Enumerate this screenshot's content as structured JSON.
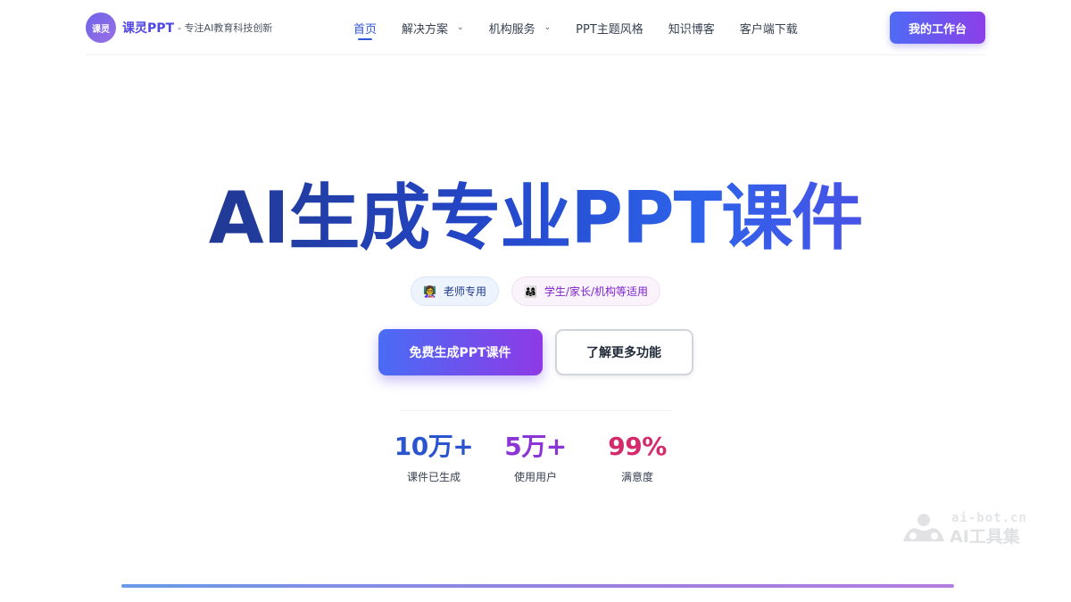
{
  "header": {
    "logo_mark": "课灵",
    "logo_name": "课灵PPT",
    "logo_tagline": "- 专注AI教育科技创新",
    "nav": [
      {
        "label": "首页",
        "active": true,
        "dropdown": false
      },
      {
        "label": "解决方案",
        "active": false,
        "dropdown": true
      },
      {
        "label": "机构服务",
        "active": false,
        "dropdown": true
      },
      {
        "label": "PPT主题风格",
        "active": false,
        "dropdown": false
      },
      {
        "label": "知识博客",
        "active": false,
        "dropdown": false
      },
      {
        "label": "客户端下载",
        "active": false,
        "dropdown": false
      }
    ],
    "workbench_label": "我的工作台"
  },
  "hero": {
    "title": "AI生成专业PPT课件",
    "tags": [
      {
        "icon": "teacher-emoji-icon",
        "label": "老师专用"
      },
      {
        "icon": "family-emoji-icon",
        "label": "学生/家长/机构等适用"
      }
    ],
    "primary_cta": "免费生成PPT课件",
    "secondary_cta": "了解更多功能"
  },
  "stats": [
    {
      "value": "10万+",
      "label": "课件已生成",
      "color": "#2b55cf"
    },
    {
      "value": "5万+",
      "label": "使用用户",
      "color": "#8b35d6"
    },
    {
      "value": "99%",
      "label": "满意度",
      "color": "#d42a6c"
    }
  ],
  "watermark": {
    "url": "ai-bot.cn",
    "name": "AI工具集"
  },
  "colors": {
    "brand": "#4f46e5",
    "accent_start": "#4a6cf4",
    "accent_end": "#8e3ae6",
    "nav_active": "#2f56d6"
  }
}
